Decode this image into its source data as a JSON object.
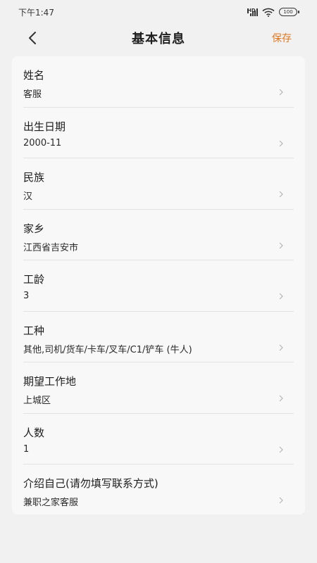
{
  "status_bar": {
    "time": "下午1:47",
    "network": "HD",
    "battery": "100"
  },
  "header": {
    "title": "基本信息",
    "save_label": "保存"
  },
  "form": {
    "rows": [
      {
        "label": "姓名",
        "value": "客服"
      },
      {
        "label": "出生日期",
        "value": "2000-11"
      },
      {
        "label": "民族",
        "value": "汉"
      },
      {
        "label": "家乡",
        "value": "江西省吉安市"
      },
      {
        "label": "工龄",
        "value": "3"
      },
      {
        "label": "工种",
        "value": "其他,司机/货车/卡车/叉车/C1/铲车 (牛人)"
      },
      {
        "label": "期望工作地",
        "value": "上城区"
      },
      {
        "label": "人数",
        "value": "1"
      },
      {
        "label": "介绍自己(请勿填写联系方式)",
        "value": "兼职之家客服"
      }
    ]
  },
  "colors": {
    "accent": "#e0771f",
    "background": "#f1f1f1",
    "card": "#f8f8f8"
  }
}
